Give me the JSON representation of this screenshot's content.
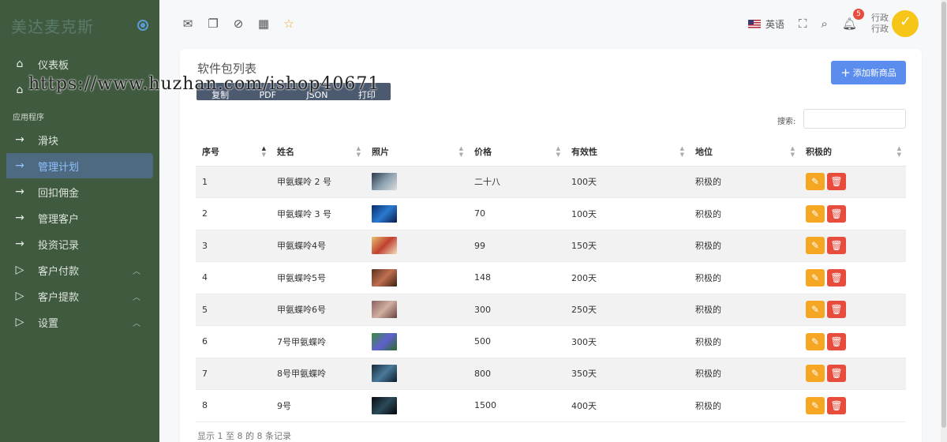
{
  "brand": {
    "name": "美达麦克斯"
  },
  "watermark": "https://www.huzhan.com/ishop40671",
  "sidebar": {
    "top_items": [
      {
        "label": "仪表板",
        "icon": "home-icon"
      },
      {
        "label": "",
        "icon": "home-icon"
      }
    ],
    "section_label": "应用程序",
    "items": [
      {
        "label": "滑块",
        "icon": "arrow-right-icon"
      },
      {
        "label": "管理计划",
        "icon": "arrow-right-icon",
        "active": true
      },
      {
        "label": "回扣佣金",
        "icon": "arrow-right-icon"
      },
      {
        "label": "管理客户",
        "icon": "arrow-right-icon"
      },
      {
        "label": "投资记录",
        "icon": "arrow-right-icon"
      },
      {
        "label": "客户付款",
        "icon": "play-icon",
        "expandable": true
      },
      {
        "label": "客户提款",
        "icon": "play-icon",
        "expandable": true
      },
      {
        "label": "设置",
        "icon": "play-icon",
        "expandable": true
      }
    ]
  },
  "header": {
    "icons": [
      "mail-icon",
      "chat-icon",
      "check-circle-icon",
      "calendar-icon",
      "star-icon"
    ],
    "language": "英语",
    "notification_count": "5",
    "user_role_line1": "行政",
    "user_role_line2": "行政"
  },
  "card": {
    "title": "软件包列表",
    "export_buttons": [
      "复制",
      "PDF",
      "JSON",
      "打印"
    ],
    "add_button_label": "添加新商品",
    "search_label": "搜索:",
    "search_value": "",
    "columns": [
      "序号",
      "姓名",
      "照片",
      "价格",
      "有效性",
      "地位",
      "积极的"
    ],
    "rows": [
      {
        "id": "1",
        "name": "甲氨蝶呤 2 号",
        "price": "二十八",
        "validity": "100天",
        "status": "积极的"
      },
      {
        "id": "2",
        "name": "甲氨蝶呤 3 号",
        "price": "70",
        "validity": "100天",
        "status": "积极的"
      },
      {
        "id": "3",
        "name": "甲氨蝶呤4号",
        "price": "99",
        "validity": "150天",
        "status": "积极的"
      },
      {
        "id": "4",
        "name": "甲氨蝶呤5号",
        "price": "148",
        "validity": "200天",
        "status": "积极的"
      },
      {
        "id": "5",
        "name": "甲氨蝶呤6号",
        "price": "300",
        "validity": "250天",
        "status": "积极的"
      },
      {
        "id": "6",
        "name": "7号甲氨蝶呤",
        "price": "500",
        "validity": "300天",
        "status": "积极的"
      },
      {
        "id": "7",
        "name": "8号甲氨蝶呤",
        "price": "800",
        "validity": "350天",
        "status": "积极的"
      },
      {
        "id": "8",
        "name": "9号",
        "price": "1500",
        "validity": "400天",
        "status": "积极的"
      }
    ],
    "footer_info": "显示 1 至 8 的 8 条记录"
  },
  "colors": {
    "sidebar_bg": "#3f5a3f",
    "accent": "#5b8def",
    "edit": "#f5a623",
    "delete": "#e74c3c"
  }
}
